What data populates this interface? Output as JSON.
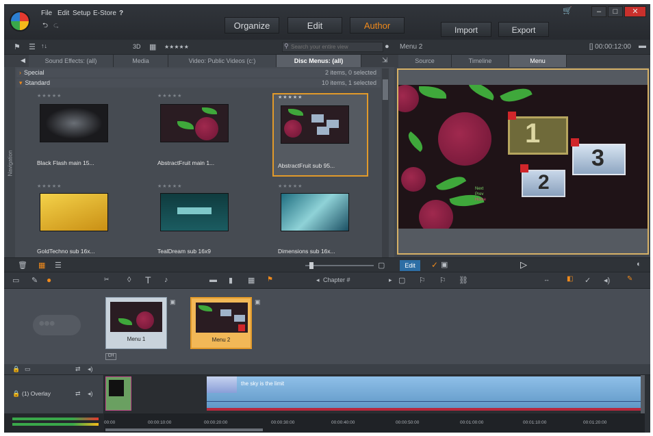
{
  "menu": {
    "file": "File",
    "edit": "Edit",
    "setup": "Setup",
    "estore": "E-Store",
    "help": "?",
    "undo": "⮌",
    "redo": "⮎"
  },
  "modes": {
    "organize": "Organize",
    "edit": "Edit",
    "author": "Author"
  },
  "io": {
    "import": "Import",
    "export": "Export"
  },
  "window": {
    "cart": "🛒",
    "min": "–",
    "max": "□",
    "close": "✕"
  },
  "library": {
    "toolbar": {
      "view3d": "3D",
      "rating": "★★★★★",
      "search_placeholder": "Search your entire view"
    },
    "navigation_label": "Navigation",
    "tabs": [
      "Sound Effects: (all)",
      "Media",
      "Video: Public Videos (c:)",
      "Disc Menus: (all)"
    ],
    "groups": [
      {
        "name": "Special",
        "info": "2 items, 0 selected"
      },
      {
        "name": "Standard",
        "info": "10 items, 1 selected"
      }
    ],
    "items": [
      {
        "label": "Black Flash main 15..."
      },
      {
        "label": "AbstractFruit main 1..."
      },
      {
        "label": "AbstractFruit sub 95..."
      },
      {
        "label": "GoldTechno sub 16x..."
      },
      {
        "label": "TealDream sub 16x9"
      },
      {
        "label": "Dimensions sub 16x..."
      }
    ]
  },
  "preview": {
    "title": "Menu 2",
    "timecode": "[] 00:00:12:00",
    "tabs": [
      "Source",
      "Timeline",
      "Menu"
    ],
    "buttons": [
      "1",
      "2",
      "3"
    ],
    "footer_edit": "Edit"
  },
  "timeline": {
    "chapter": "Chapter #",
    "menus": [
      {
        "label": "Menu 1"
      },
      {
        "label": "Menu 2"
      }
    ],
    "track_label": "(1) Overlay",
    "clip_title": "the sky is the limit",
    "ruler": [
      "00:00",
      "00:00:10:00",
      "00:00:20:00",
      "00:00:30:00",
      "00:00:40:00",
      "00:00:50:00",
      "00:01:00:00",
      "00:01:10:00",
      "00:01:20:00"
    ]
  },
  "colors": {
    "author": "#f08a1c",
    "selection": "#e29a2a",
    "preview_border": "#d7b267",
    "clip": "#8fbfe8"
  }
}
